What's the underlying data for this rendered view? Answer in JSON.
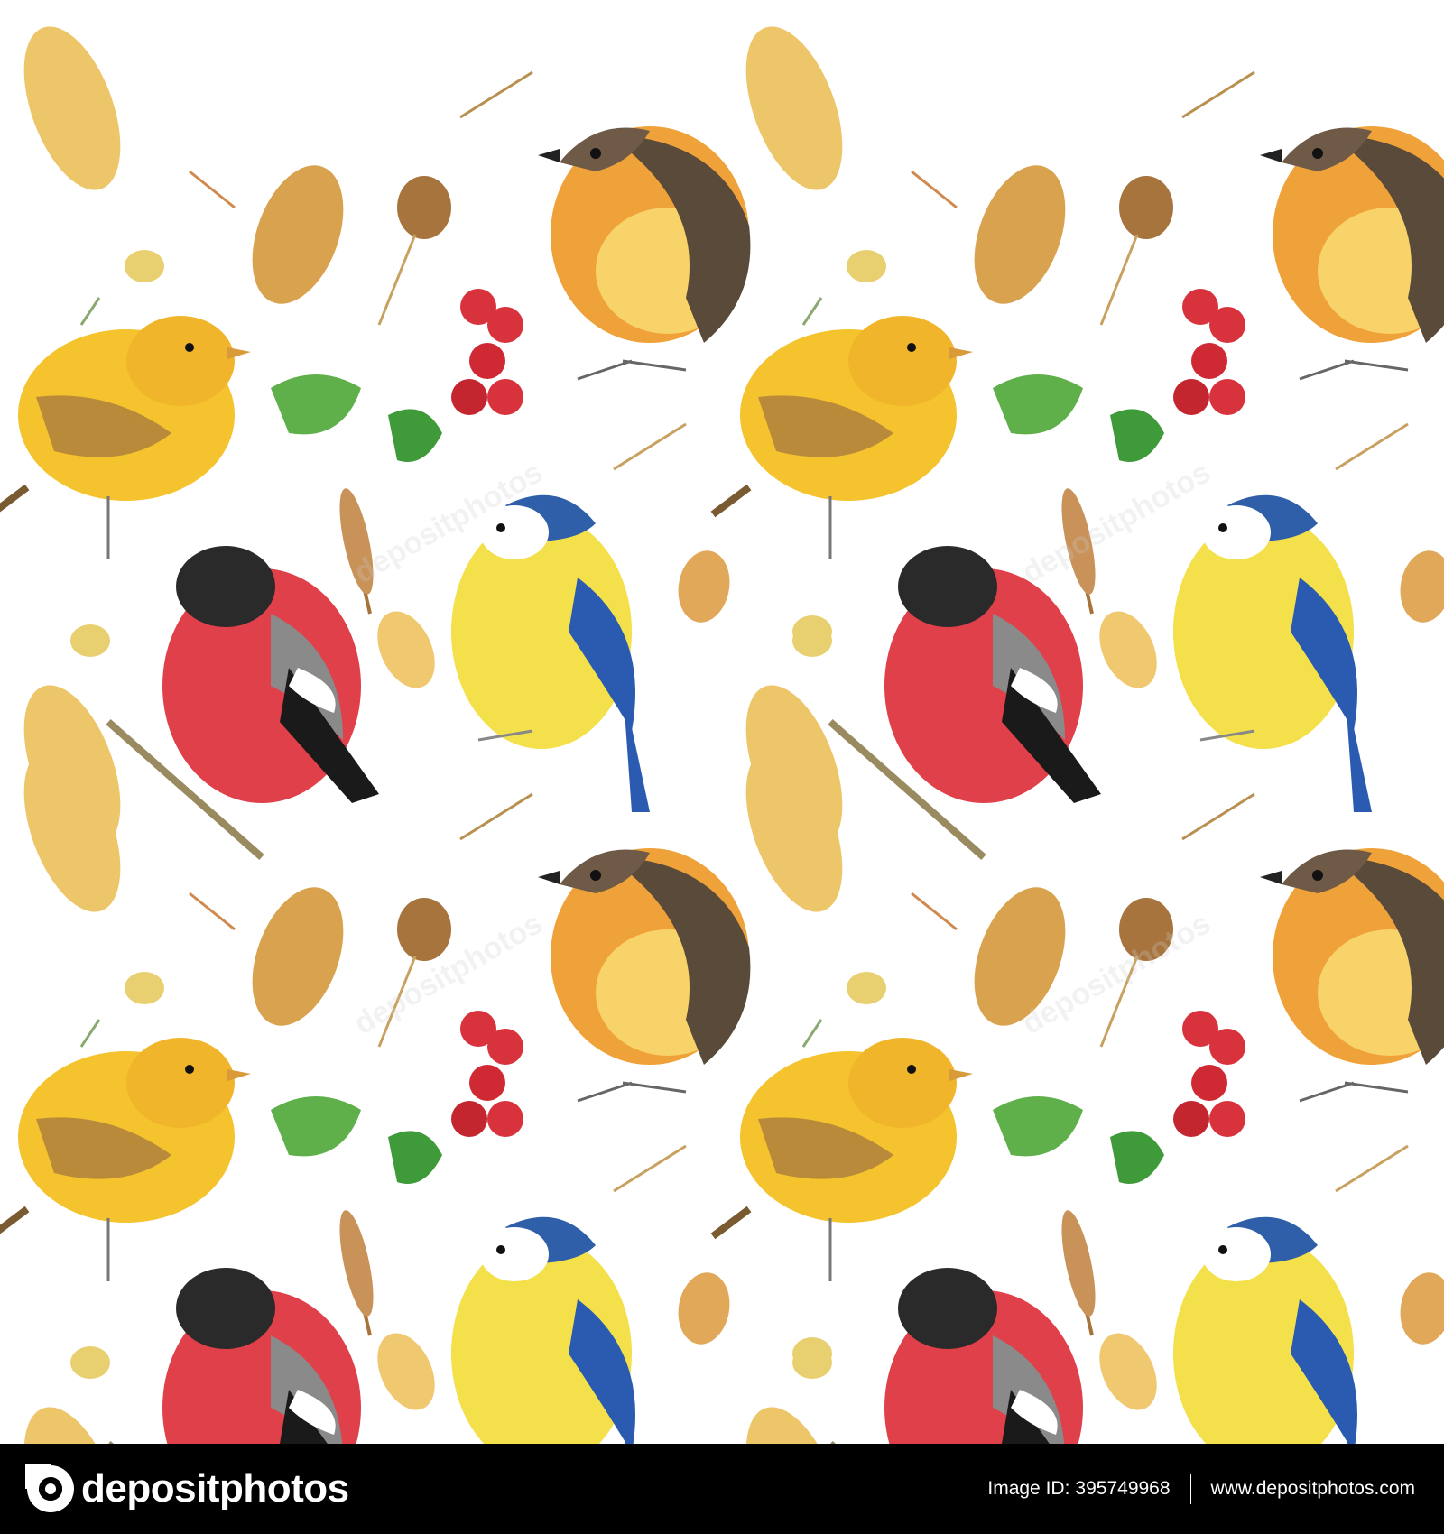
{
  "footer": {
    "logo_text": "depositphotos",
    "image_id_label": "Image ID:",
    "image_id": "395749968",
    "website": "www.depositphotos.com"
  },
  "watermark": "depositphotos",
  "colors": {
    "footer_bg": "#000000",
    "background": "#ffffff"
  },
  "icons": [
    "depositphotos-logo-icon"
  ]
}
